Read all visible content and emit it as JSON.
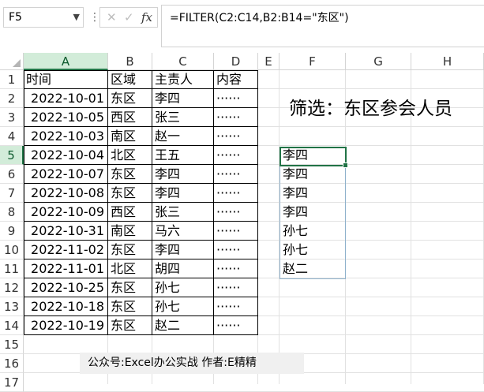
{
  "name_box": "F5",
  "formula_buttons": {
    "cancel": "✕",
    "enter": "✓",
    "fx": "fx"
  },
  "formula": "=FILTER(C2:C14,B2:B14=\"东区\")",
  "columns": [
    "A",
    "B",
    "C",
    "D",
    "E",
    "F",
    "G",
    "H"
  ],
  "rows": [
    "1",
    "2",
    "3",
    "4",
    "5",
    "6",
    "7",
    "8",
    "9",
    "10",
    "11",
    "12",
    "13",
    "14",
    "15",
    "16",
    "17"
  ],
  "header": {
    "time": "时间",
    "region": "区域",
    "owner": "主责人",
    "content": "内容"
  },
  "records": [
    {
      "date": "2022-10-01",
      "region": "东区",
      "owner": "李四",
      "content": "······"
    },
    {
      "date": "2022-10-05",
      "region": "西区",
      "owner": "张三",
      "content": "······"
    },
    {
      "date": "2022-10-03",
      "region": "南区",
      "owner": "赵一",
      "content": "······"
    },
    {
      "date": "2022-10-04",
      "region": "北区",
      "owner": "王五",
      "content": "······"
    },
    {
      "date": "2022-10-07",
      "region": "东区",
      "owner": "李四",
      "content": "······"
    },
    {
      "date": "2022-10-08",
      "region": "东区",
      "owner": "李四",
      "content": "······"
    },
    {
      "date": "2022-10-09",
      "region": "西区",
      "owner": "张三",
      "content": "······"
    },
    {
      "date": "2022-10-31",
      "region": "南区",
      "owner": "马六",
      "content": "······"
    },
    {
      "date": "2022-11-02",
      "region": "东区",
      "owner": "李四",
      "content": "······"
    },
    {
      "date": "2022-11-01",
      "region": "北区",
      "owner": "胡四",
      "content": "······"
    },
    {
      "date": "2022-10-25",
      "region": "东区",
      "owner": "孙七",
      "content": "······"
    },
    {
      "date": "2022-10-18",
      "region": "东区",
      "owner": "孙七",
      "content": "······"
    },
    {
      "date": "2022-10-19",
      "region": "东区",
      "owner": "赵二",
      "content": "······"
    }
  ],
  "heading": "筛选：东区参会人员",
  "filter_results": [
    "李四",
    "李四",
    "李四",
    "李四",
    "孙七",
    "孙七",
    "赵二"
  ],
  "footer": "公众号:Excel办公实战  作者:E精精",
  "colors": {
    "selection": "#217346",
    "header_selected": "#d2ecd9"
  }
}
